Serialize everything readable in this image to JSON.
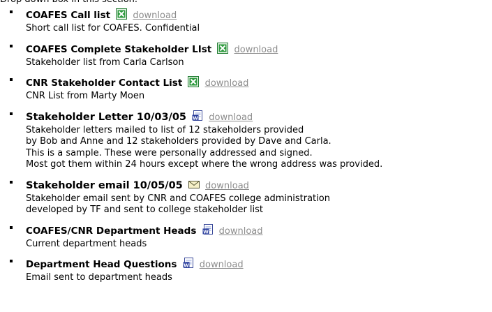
{
  "intro_text": "Drop down box in this section.",
  "files": [
    {
      "title": "COAFES Call list",
      "icon": "excel-icon",
      "link": "download",
      "desc": [
        "Short call list for COAFES. Confidential"
      ]
    },
    {
      "title": "COAFES Complete Stakeholder LIst",
      "icon": "excel-icon",
      "link": "download",
      "desc": [
        "Stakeholder list from Carla Carlson"
      ]
    },
    {
      "title": "CNR Stakeholder Contact List",
      "icon": "excel-icon",
      "link": "download",
      "desc": [
        "CNR List from Marty Moen"
      ]
    },
    {
      "title": "Stakeholder Letter 10/03/05",
      "icon": "word-icon",
      "link": "download",
      "desc": [
        "Stakeholder letters mailed to list of 12 stakeholders provided",
        "by Bob and Anne and 12 stakeholders provided by Dave and Carla.",
        "This is a sample. These were personally addressed and signed.",
        "Most got them within 24 hours except where the wrong address was provided."
      ]
    },
    {
      "title": "Stakeholder email 10/05/05",
      "icon": "email-icon",
      "link": "download",
      "desc": [
        "Stakeholder email sent by CNR and COAFES college administration",
        "developed by TF and sent to college stakeholder list"
      ]
    },
    {
      "title": "COAFES/CNR Department Heads",
      "icon": "word-icon",
      "link": "download",
      "desc": [
        "Current department heads"
      ]
    },
    {
      "title": "Department Head Questions",
      "icon": "word-icon",
      "link": "download",
      "desc": [
        "Email sent to department heads"
      ]
    }
  ]
}
